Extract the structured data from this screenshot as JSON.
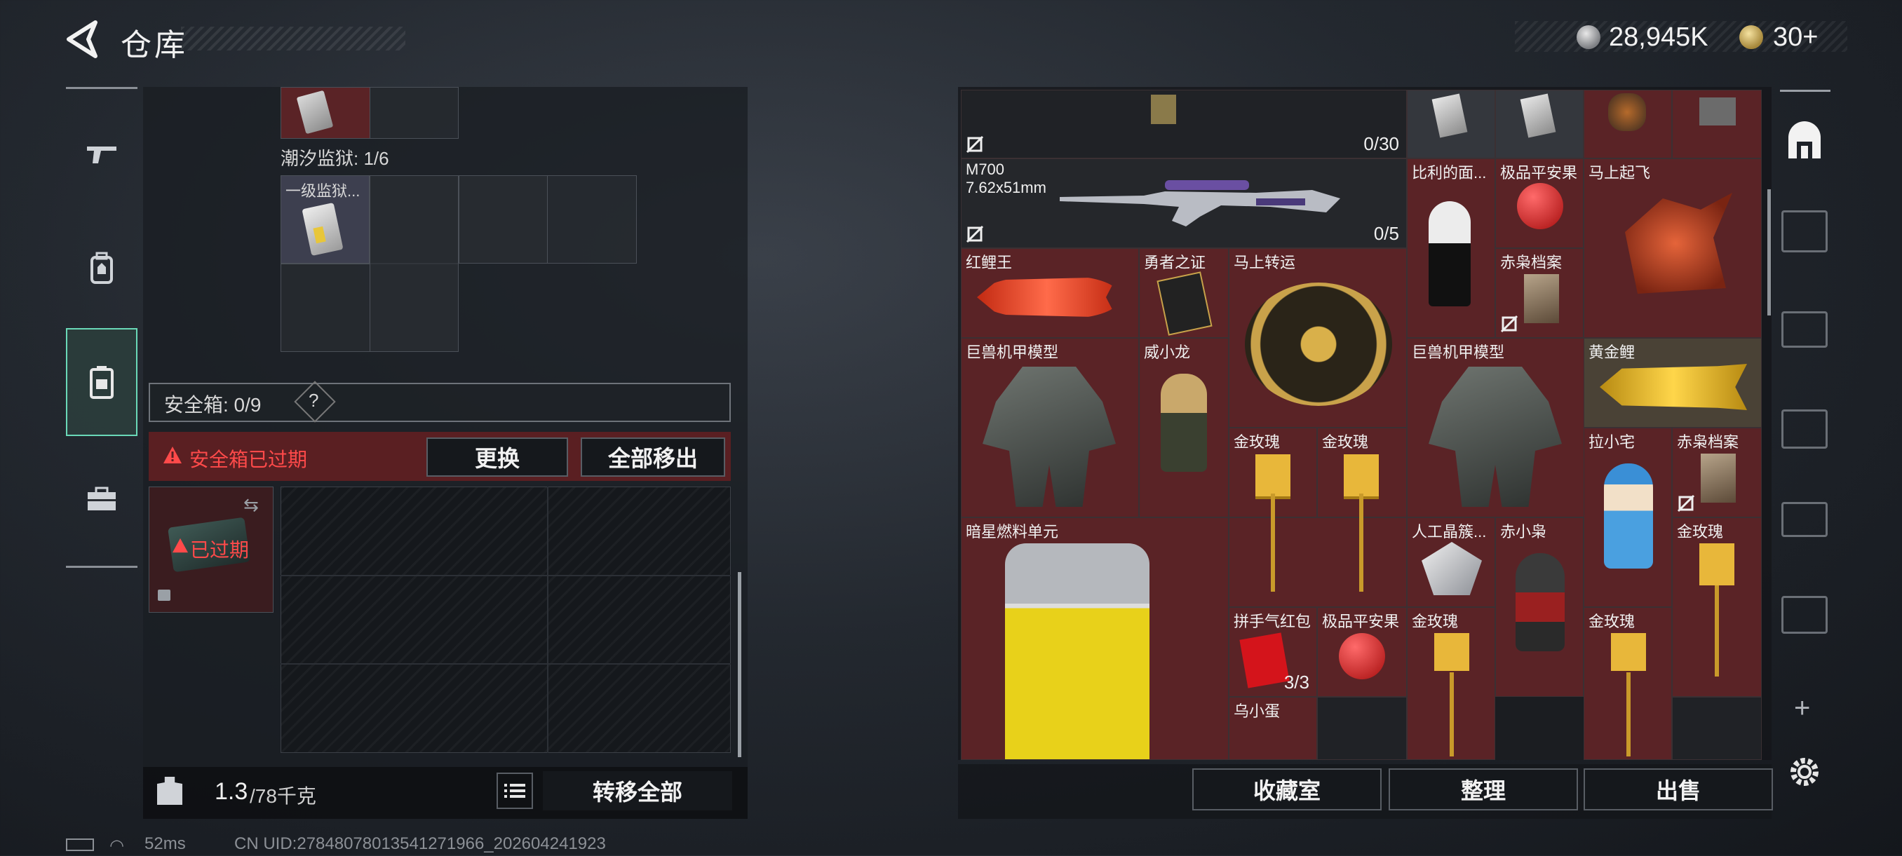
{
  "header": {
    "title": "仓库",
    "currency_amount": "28,945K",
    "tickets": "30+"
  },
  "left_nav": {
    "icons": [
      "gun-icon",
      "backpack-icon",
      "safebox-icon",
      "toolbox-icon"
    ]
  },
  "left_panel": {
    "container_label": "潮汐监狱: 1/6",
    "container_item": "一级监狱...",
    "safebox_label": "安全箱: 0/9",
    "safebox_help": "?",
    "expired_text": "安全箱已过期",
    "replace_button": "更换",
    "remove_all_button": "全部移出",
    "expired_badge": "已过期",
    "weight_value": "1.3",
    "weight_total": "/78千克",
    "transfer_all_button": "转移全部"
  },
  "stash": {
    "top_count": "0/30",
    "weapon_name": "M700",
    "weapon_caliber": "7.62x51mm",
    "weapon_count": "0/5",
    "items": {
      "bili": "比利的面...",
      "apple1": "极品平安果",
      "mashang_fei": "马上起飞",
      "carp": "红鲤王",
      "yongzhe": "勇者之证",
      "zhuanyun": "马上转运",
      "chixiao1": "赤枭档案",
      "mech1": "巨兽机甲模型",
      "weixiaolong": "威小龙",
      "mech2": "巨兽机甲模型",
      "goldcarp": "黄金鲤",
      "rose1": "金玫瑰",
      "rose2": "金玫瑰",
      "laxiaozhai": "拉小宅",
      "chixiao2": "赤枭档案",
      "fuel": "暗星燃料单元",
      "crystal": "人工晶簇...",
      "chixiaoxiao": "赤小枭",
      "rose3": "金玫瑰",
      "hongbao": "拼手气红包",
      "hongbao_count": "3/3",
      "apple2": "极品平安果",
      "rose4": "金玫瑰",
      "rose5": "金玫瑰",
      "wuxiaodan": "乌小蛋"
    }
  },
  "bottom": {
    "collection_button": "收藏室",
    "sort_button": "整理",
    "sell_button": "出售"
  },
  "status": {
    "ping": "52ms",
    "uid": "CN UID:27848078013541271966_202604241923"
  }
}
